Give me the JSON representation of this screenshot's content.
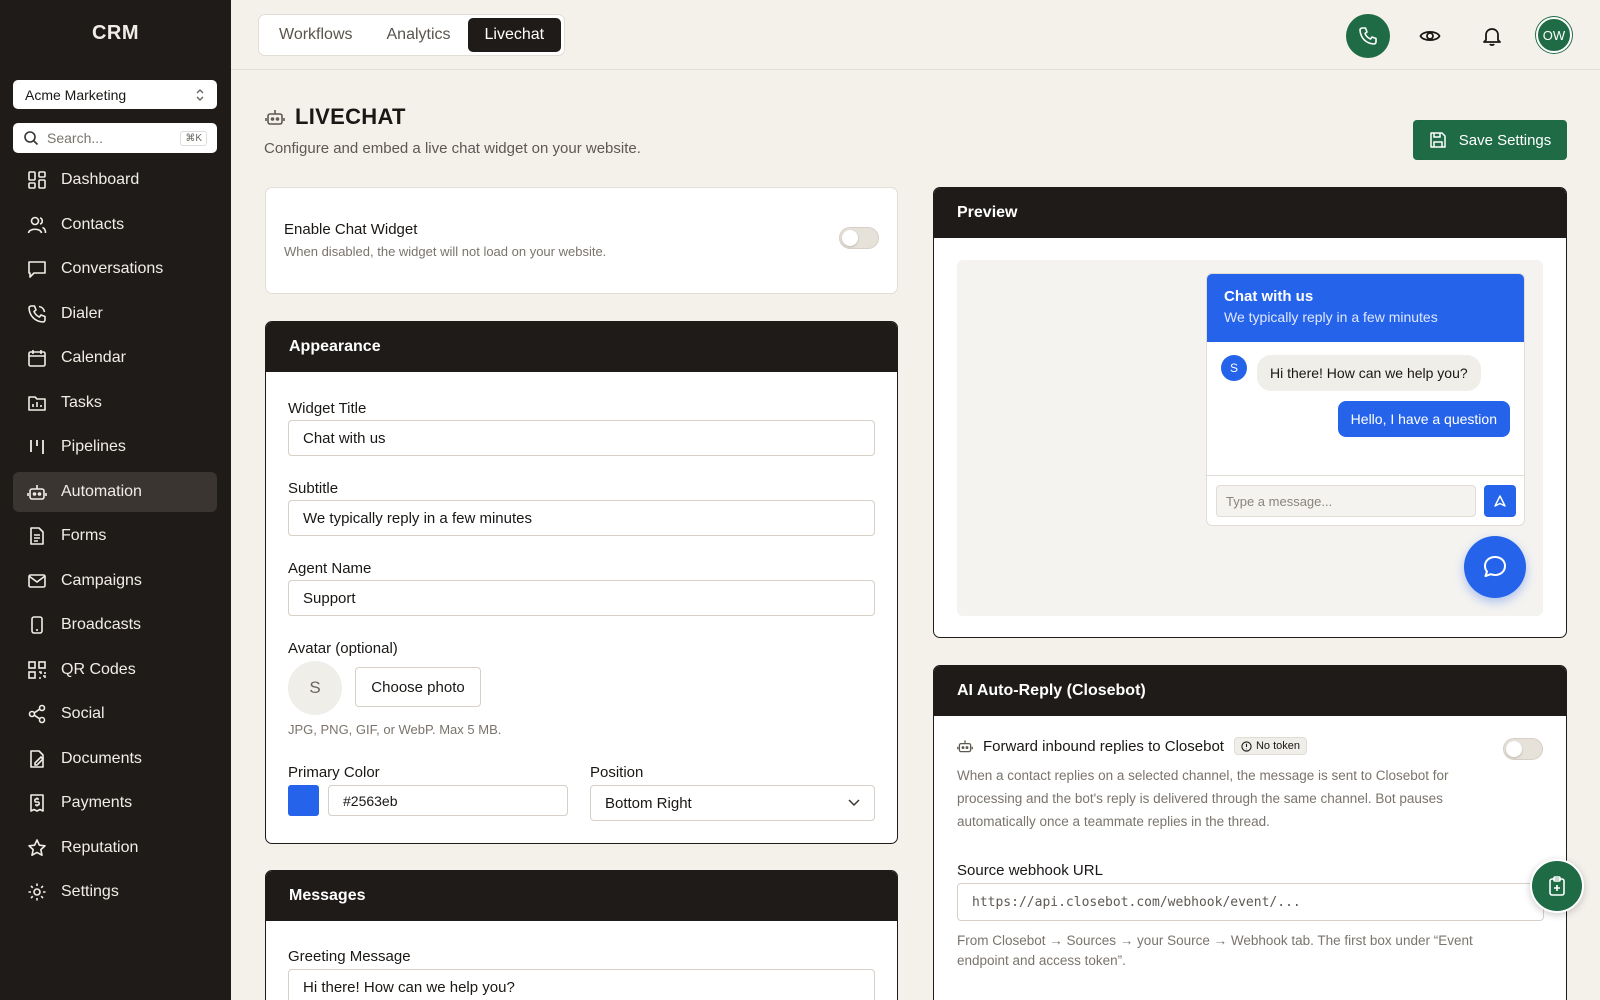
{
  "sidebar": {
    "brand": "CRM",
    "workspace": "Acme Marketing",
    "search_placeholder": "Search...",
    "search_shortcut": "⌘K",
    "items": [
      {
        "label": "Dashboard",
        "icon": "dashboard-icon"
      },
      {
        "label": "Contacts",
        "icon": "users-icon"
      },
      {
        "label": "Conversations",
        "icon": "message-icon"
      },
      {
        "label": "Dialer",
        "icon": "phone-icon"
      },
      {
        "label": "Calendar",
        "icon": "calendar-icon"
      },
      {
        "label": "Tasks",
        "icon": "folder-icon"
      },
      {
        "label": "Pipelines",
        "icon": "pipeline-icon"
      },
      {
        "label": "Automation",
        "icon": "robot-icon",
        "active": true
      },
      {
        "label": "Forms",
        "icon": "form-icon"
      },
      {
        "label": "Campaigns",
        "icon": "mail-icon"
      },
      {
        "label": "Broadcasts",
        "icon": "phone-device-icon"
      },
      {
        "label": "QR Codes",
        "icon": "qr-icon"
      },
      {
        "label": "Social",
        "icon": "share-icon"
      },
      {
        "label": "Documents",
        "icon": "document-icon"
      },
      {
        "label": "Payments",
        "icon": "receipt-icon"
      },
      {
        "label": "Reputation",
        "icon": "star-icon"
      },
      {
        "label": "Settings",
        "icon": "gear-icon"
      }
    ]
  },
  "topbar": {
    "tabs": [
      {
        "label": "Workflows",
        "active": false
      },
      {
        "label": "Analytics",
        "active": false
      },
      {
        "label": "Livechat",
        "active": true
      }
    ],
    "avatar_initials": "OW"
  },
  "page": {
    "title": "LIVECHAT",
    "subtitle": "Configure and embed a live chat widget on your website.",
    "save_label": "Save Settings"
  },
  "enable": {
    "title": "Enable Chat Widget",
    "description": "When disabled, the widget will not load on your website.",
    "enabled": false
  },
  "appearance": {
    "heading": "Appearance",
    "widget_title_label": "Widget Title",
    "widget_title_value": "Chat with us",
    "subtitle_label": "Subtitle",
    "subtitle_value": "We typically reply in a few minutes",
    "agent_name_label": "Agent Name",
    "agent_name_value": "Support",
    "avatar_label": "Avatar (optional)",
    "avatar_initial": "S",
    "choose_photo_label": "Choose photo",
    "avatar_hint": "JPG, PNG, GIF, or WebP. Max 5 MB.",
    "primary_color_label": "Primary Color",
    "primary_color_value": "#2563eb",
    "position_label": "Position",
    "position_value": "Bottom Right"
  },
  "messages": {
    "heading": "Messages",
    "greeting_label": "Greeting Message",
    "greeting_value": "Hi there! How can we help you?"
  },
  "preview": {
    "heading": "Preview",
    "chat_title": "Chat with us",
    "chat_subtitle": "We typically reply in a few minutes",
    "agent_initial": "S",
    "agent_message": "Hi there! How can we help you?",
    "user_message": "Hello, I have a question",
    "input_placeholder": "Type a message..."
  },
  "ai": {
    "heading": "AI Auto-Reply (Closebot)",
    "forward_label": "Forward inbound replies to Closebot",
    "badge": "No token",
    "enabled": false,
    "description": "When a contact replies on a selected channel, the message is sent to Closebot for processing and the bot's reply is delivered through the same channel. Bot pauses automatically once a teammate replies in the thread.",
    "webhook_label": "Source webhook URL",
    "webhook_placeholder": "https://api.closebot.com/webhook/event/...",
    "webhook_hint": "From Closebot → Sources → your Source → Webhook tab. The first box under “Event endpoint and access token”."
  },
  "colors": {
    "sidebar_bg": "#1f1b18",
    "accent_green": "#1f6b45",
    "chat_blue": "#2563eb"
  }
}
